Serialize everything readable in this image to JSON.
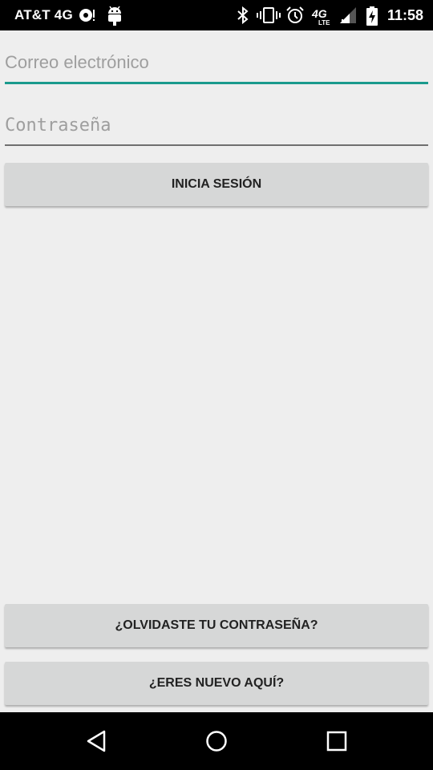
{
  "status_bar": {
    "carrier": "AT&T 4G",
    "time": "11:58",
    "icons": [
      "sync-icon",
      "android-debug-icon",
      "bluetooth-icon",
      "vibrate-icon",
      "alarm-icon",
      "4g-lte-icon",
      "signal-icon",
      "battery-charging-icon"
    ]
  },
  "login": {
    "email_placeholder": "Correo electrónico",
    "password_placeholder": "Contraseña",
    "login_label": "INICIA SESIÓN"
  },
  "footer": {
    "forgot_label": "¿OLVIDASTE TU CONTRASEÑA?",
    "new_label": "¿ERES NUEVO AQUÍ?"
  },
  "nav_bar": {
    "icons": [
      "back-icon",
      "home-icon",
      "recents-icon"
    ]
  },
  "colors": {
    "accent": "#1a9a8d",
    "background": "#eeeeee",
    "button": "#d6d7d7"
  }
}
